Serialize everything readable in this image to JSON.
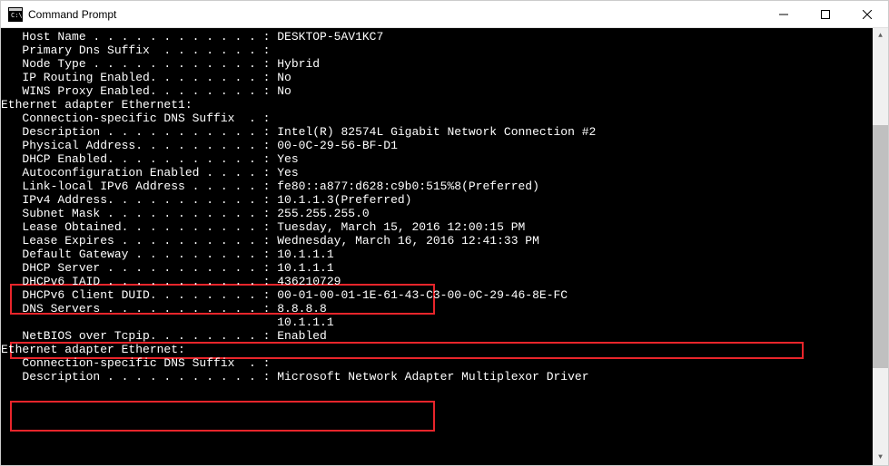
{
  "window": {
    "title": "Command Prompt"
  },
  "output": {
    "host_name_label": "   Host Name . . . . . . . . . . . . : ",
    "host_name_value": "DESKTOP-5AV1KC7",
    "primary_dns_label": "   Primary Dns Suffix  . . . . . . . :",
    "primary_dns_value": "",
    "node_type_label": "   Node Type . . . . . . . . . . . . : ",
    "node_type_value": "Hybrid",
    "ip_routing_label": "   IP Routing Enabled. . . . . . . . : ",
    "ip_routing_value": "No",
    "wins_proxy_label": "   WINS Proxy Enabled. . . . . . . . : ",
    "wins_proxy_value": "No",
    "blank1": "",
    "adapter1_header": "Ethernet adapter Ethernet1:",
    "blank2": "",
    "conn_suffix1_label": "   Connection-specific DNS Suffix  . :",
    "conn_suffix1_value": "",
    "description1_label": "   Description . . . . . . . . . . . : ",
    "description1_value": "Intel(R) 82574L Gigabit Network Connection #2",
    "physaddr_label": "   Physical Address. . . . . . . . . : ",
    "physaddr_value": "00-0C-29-56-BF-D1",
    "dhcp_enabled_label": "   DHCP Enabled. . . . . . . . . . . : ",
    "dhcp_enabled_value": "Yes",
    "autoconfig_label": "   Autoconfiguration Enabled . . . . : ",
    "autoconfig_value": "Yes",
    "linklocal_label": "   Link-local IPv6 Address . . . . . : ",
    "linklocal_value": "fe80::a877:d628:c9b0:515%8(Preferred)",
    "ipv4_label": "   IPv4 Address. . . . . . . . . . . : ",
    "ipv4_value": "10.1.1.3(Preferred)",
    "subnet_label": "   Subnet Mask . . . . . . . . . . . : ",
    "subnet_value": "255.255.255.0",
    "lease_obt_label": "   Lease Obtained. . . . . . . . . . : ",
    "lease_obt_value": "Tuesday, March 15, 2016 12:00:15 PM",
    "lease_exp_label": "   Lease Expires . . . . . . . . . . : ",
    "lease_exp_value": "Wednesday, March 16, 2016 12:41:33 PM",
    "gateway_label": "   Default Gateway . . . . . . . . . : ",
    "gateway_value": "10.1.1.1",
    "dhcp_server_label": "   DHCP Server . . . . . . . . . . . : ",
    "dhcp_server_value": "10.1.1.1",
    "dhcpv6_iaid_label": "   DHCPv6 IAID . . . . . . . . . . . : ",
    "dhcpv6_iaid_value": "436210729",
    "dhcpv6_duid_label": "   DHCPv6 Client DUID. . . . . . . . : ",
    "dhcpv6_duid_value": "00-01-00-01-1E-61-43-C3-00-0C-29-46-8E-FC",
    "dns_label": "   DNS Servers . . . . . . . . . . . : ",
    "dns_value1": "8.8.8.8",
    "dns_cont_label": "                                       ",
    "dns_value2": "10.1.1.1",
    "netbios_label": "   NetBIOS over Tcpip. . . . . . . . : ",
    "netbios_value": "Enabled",
    "blank3": "",
    "adapter2_header": "Ethernet adapter Ethernet:",
    "blank4": "",
    "conn_suffix2_label": "   Connection-specific DNS Suffix  . :",
    "conn_suffix2_value": "",
    "description2_label": "   Description . . . . . . . . . . . : ",
    "description2_value": "Microsoft Network Adapter Multiplexor Driver"
  }
}
